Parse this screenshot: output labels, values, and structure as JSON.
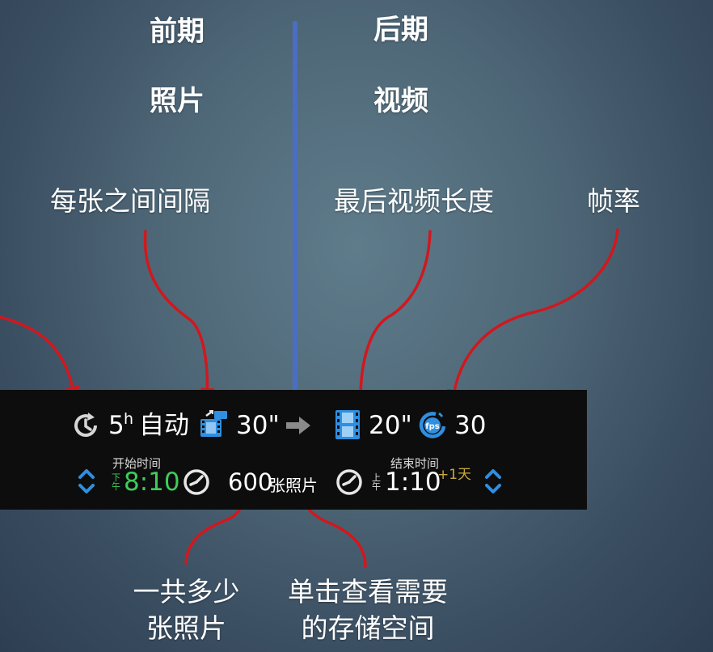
{
  "header": {
    "left_phase": "前期",
    "right_phase": "后期",
    "left_type": "照片",
    "right_type": "视频"
  },
  "annotations": {
    "interval": "每张之间间隔",
    "video_length": "最后视频长度",
    "frame_rate": "帧率",
    "total_photos_line1": "一共多少",
    "total_photos_line2": "张照片",
    "storage_line1": "单击查看需要",
    "storage_line2": "的存储空间"
  },
  "control_bar": {
    "duration_value": "5",
    "duration_unit": "h",
    "mode": "自动",
    "interval_value": "30\"",
    "video_length_value": "20\"",
    "fps_icon_label": "fps",
    "fps_value": "30",
    "start_label": "开始时间",
    "start_time": "8:10",
    "start_ampm": "下午",
    "photo_count": "600",
    "photo_unit": "张照片",
    "end_label": "结束时间",
    "end_time": "1:10",
    "end_ampm": "上午",
    "end_day_offset": "+1天"
  },
  "icons": {
    "duration": "clock-rotate-icon",
    "interval": "film-interval-icon",
    "arrow": "arrow-right-icon",
    "video": "film-strip-icon",
    "fps": "fps-gauge-icon",
    "start_stepper": "up-down-chevron-icon",
    "start_clock": "clock-icon",
    "end_clock": "clock-icon",
    "end_stepper": "up-down-chevron-icon"
  },
  "colors": {
    "divider": "#4a6dc6",
    "annotation_arrow": "#d0181e",
    "accent_blue": "#2f8fe0",
    "start_time": "#3fcc5a",
    "day_offset": "#c9a93b",
    "bar_background": "#0d0d0d"
  }
}
